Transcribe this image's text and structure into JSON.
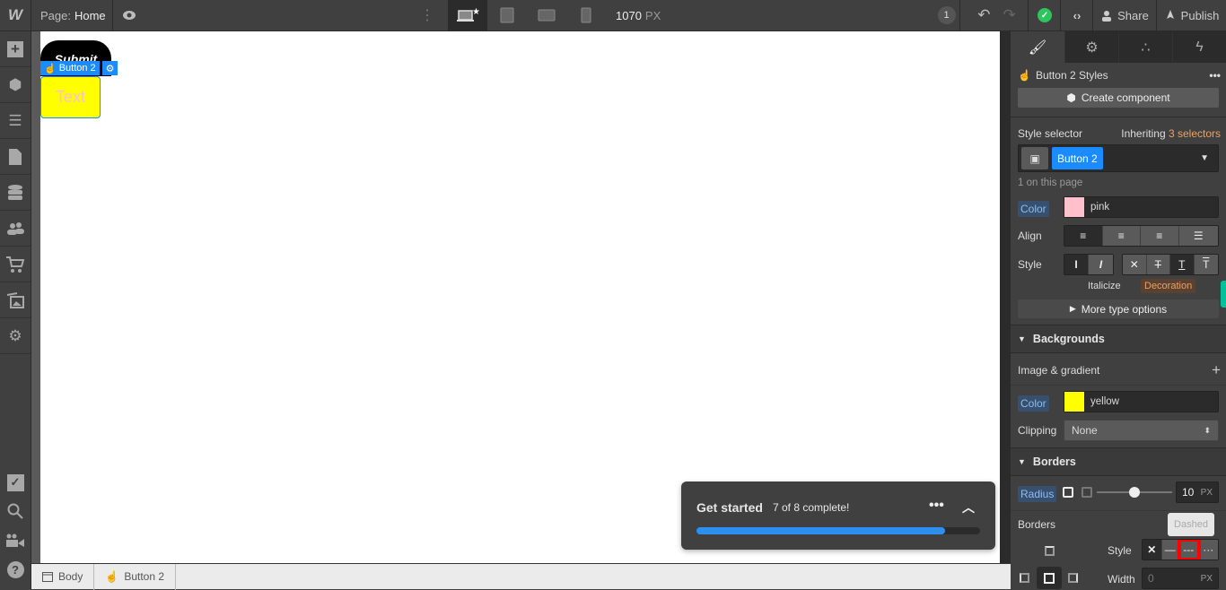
{
  "topbar": {
    "logo": "W",
    "page_label": "Page:",
    "page_name": "Home",
    "viewport_width": "1070",
    "viewport_unit": "PX",
    "notification_count": "1",
    "share_label": "Share",
    "publish_label": "Publish"
  },
  "canvas": {
    "submit_text": "Submit",
    "selected_label": "Button 2",
    "selected_text": "Text"
  },
  "breadcrumbs": [
    {
      "label": "Body"
    },
    {
      "label": "Button 2"
    }
  ],
  "get_started": {
    "title": "Get started",
    "count": "7 of 8 complete!",
    "progress_fraction": 0.875
  },
  "right_panel": {
    "styles_title": "Button 2 Styles",
    "create_component": "Create component",
    "style_selector_label": "Style selector",
    "inheriting_label": "Inheriting",
    "inheriting_count": "3 selectors",
    "selector_chip": "Button 2",
    "on_page": "1 on this page",
    "typography": {
      "color_label": "Color",
      "color_value": "pink",
      "color_hex": "#ffc0cb",
      "align_label": "Align",
      "style_label": "Style",
      "italicize_label": "Italicize",
      "decoration_label": "Decoration",
      "more_type": "More type options"
    },
    "backgrounds": {
      "title": "Backgrounds",
      "image_gradient": "Image & gradient",
      "color_label": "Color",
      "color_value": "yellow",
      "color_hex": "#ffff00",
      "clipping_label": "Clipping",
      "clipping_value": "None"
    },
    "borders": {
      "title": "Borders",
      "radius_label": "Radius",
      "radius_value": "10",
      "radius_unit": "PX",
      "borders_label": "Borders",
      "style_label": "Style",
      "tooltip": "Dashed",
      "width_label": "Width",
      "width_placeholder": "0",
      "width_unit": "PX"
    }
  },
  "colors": {
    "accent": "#1a8cff",
    "highlight_box": "#ff0000",
    "orange": "#f0a05a",
    "success": "#2dc55e"
  }
}
